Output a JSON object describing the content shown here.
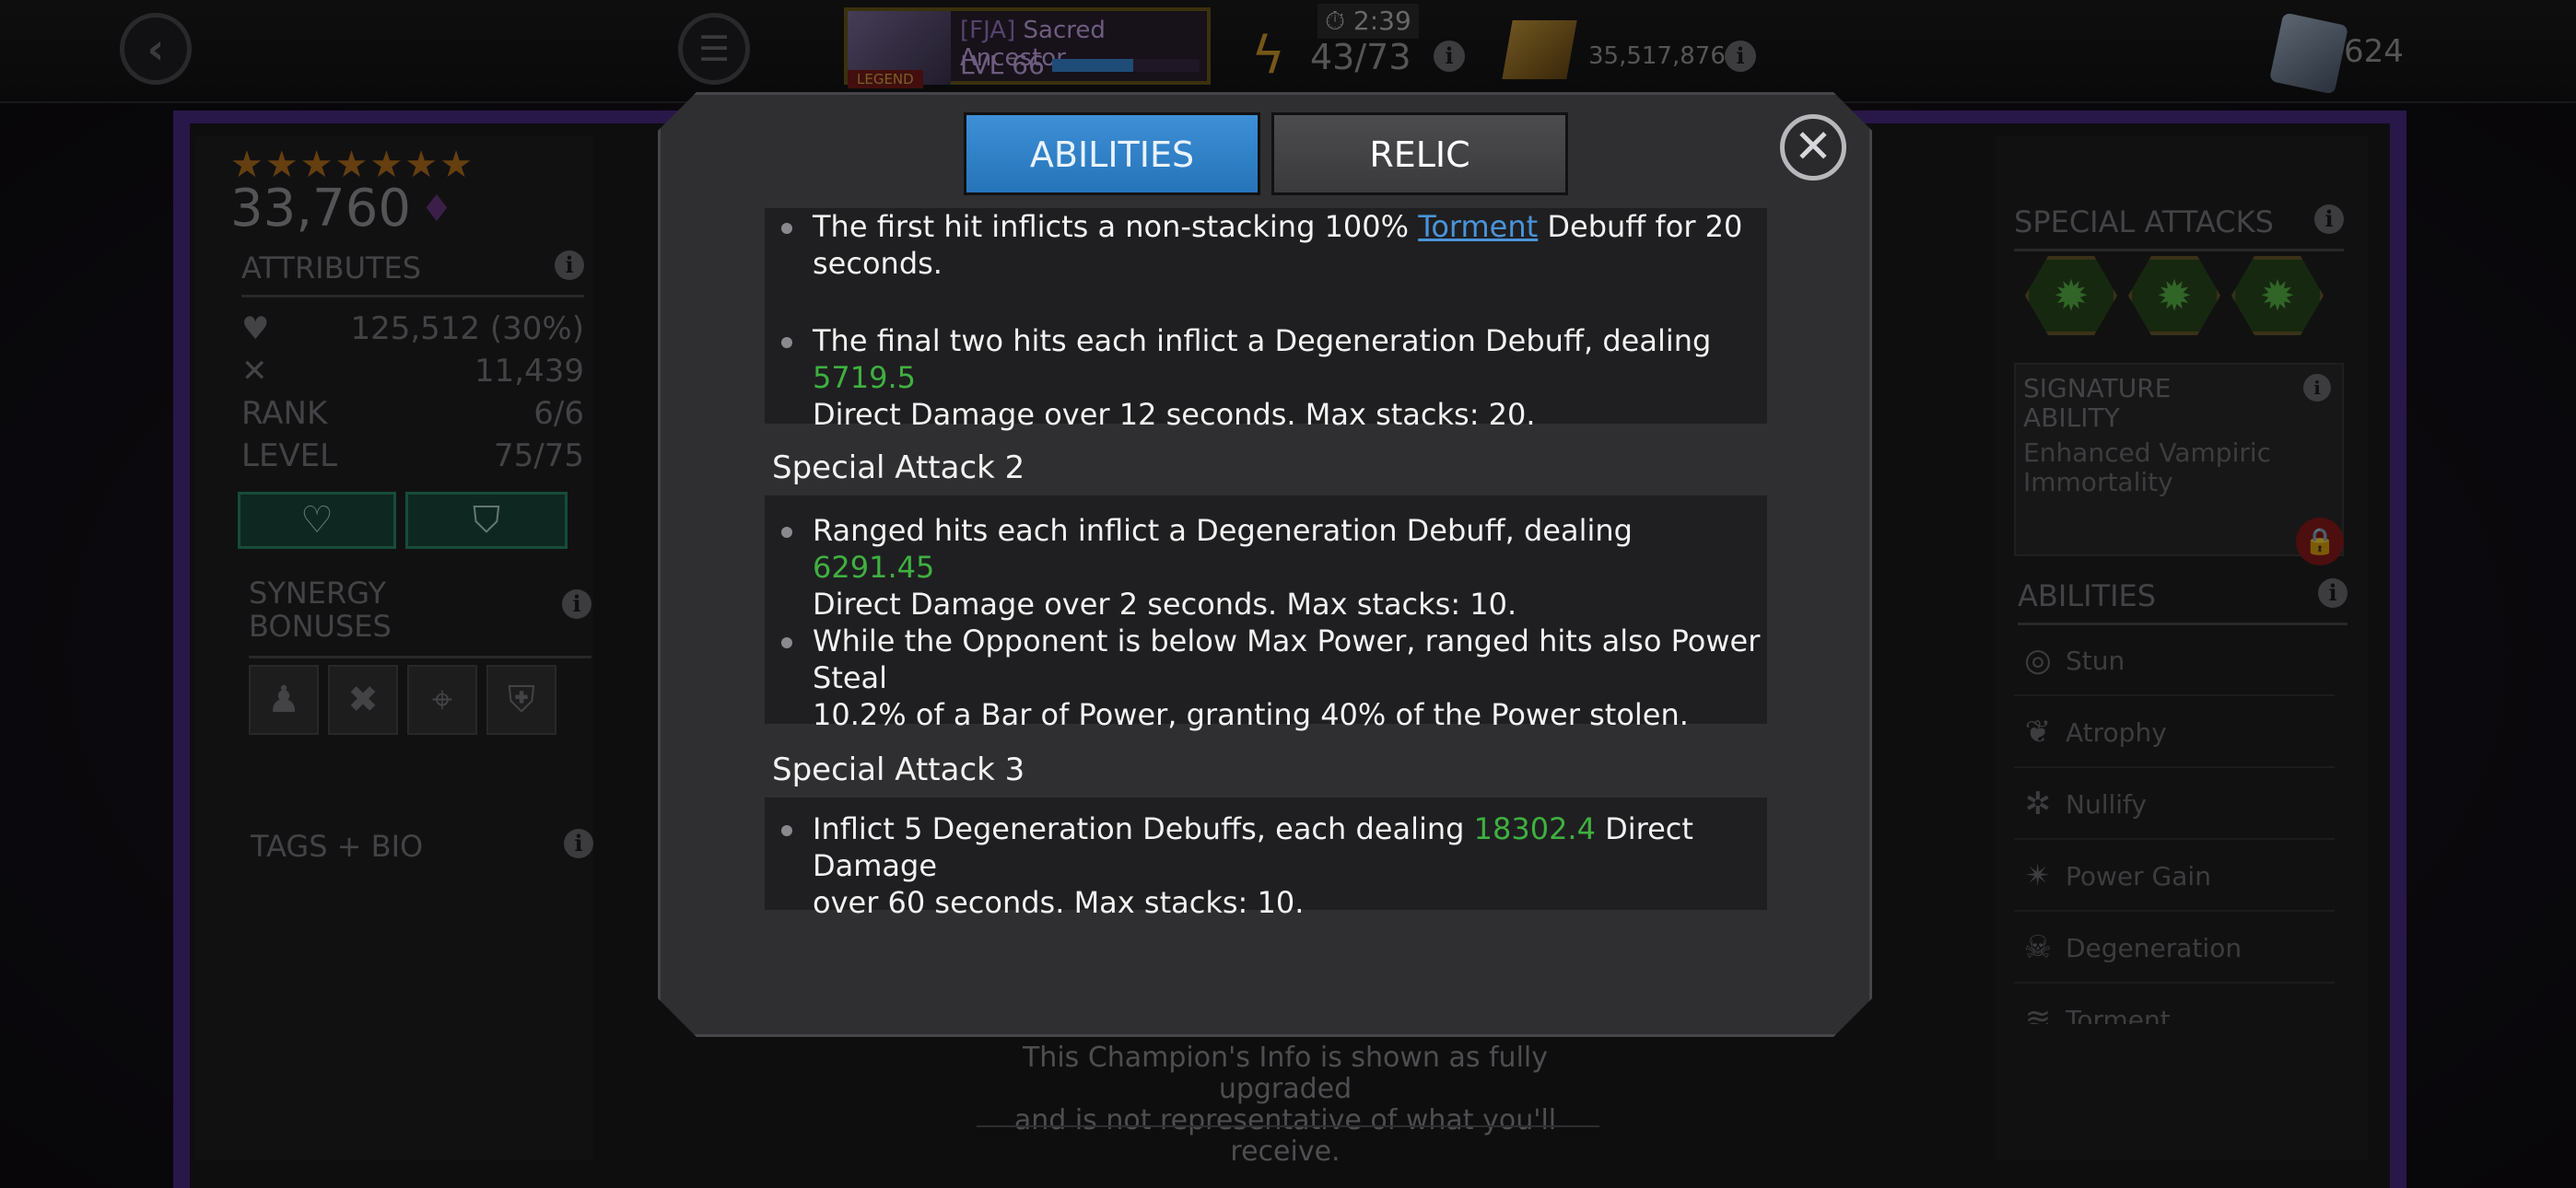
{
  "topbar": {
    "back_icon": "back-arrow-icon",
    "menu_icon": "hamburger-menu-icon",
    "profile": {
      "legend_badge": "LEGEND",
      "alliance_tag": "[FJA]",
      "name": "Sacred Ancestor",
      "level": "LVL 66",
      "level_progress": 0.55
    },
    "energy": {
      "timer": "2:39",
      "value": "43/73"
    },
    "gold": {
      "value": "35,517,876"
    },
    "units": {
      "value": "624"
    }
  },
  "champion": {
    "stars": "★★★★★★★",
    "rating": "33,760",
    "attributes": {
      "title": "ATTRIBUTES",
      "health": "125,512",
      "health_bonus": "30%",
      "attack": "11,439",
      "rank_label": "RANK",
      "rank": "6/6",
      "level_label": "LEVEL",
      "level": "75/75"
    },
    "synergy_title_line1": "SYNERGY",
    "synergy_title_line2": "BONUSES",
    "tags_bio": "TAGS + BIO"
  },
  "right_panel": {
    "special_attacks_title": "SPECIAL ATTACKS",
    "signature_title_line1": "SIGNATURE",
    "signature_title_line2": "ABILITY",
    "signature_name_line1": "Enhanced Vampiric",
    "signature_name_line2": "Immortality",
    "abilities_title": "ABILITIES",
    "abilities": [
      {
        "name": "Stun",
        "icon": "stun-icon"
      },
      {
        "name": "Atrophy",
        "icon": "atrophy-icon"
      },
      {
        "name": "Nullify",
        "icon": "nullify-icon"
      },
      {
        "name": "Power Gain",
        "icon": "power-gain-icon"
      },
      {
        "name": "Degeneration",
        "icon": "degeneration-icon"
      },
      {
        "name": "Torment",
        "icon": "torment-icon"
      }
    ]
  },
  "disclaimer_line1": "This Champion's Info is shown as fully upgraded",
  "disclaimer_line2": "and is not representative of what you'll receive.",
  "modal": {
    "tabs": {
      "abilities": "ABILITIES",
      "relic": "RELIC"
    },
    "sa1": {
      "b1_pre": "The first hit inflicts a non-stacking 100% ",
      "b1_link": "Torment",
      "b1_post": " Debuff for 20",
      "b1_line2": "seconds.",
      "b2_pre": "The final two hits each inflict a Degeneration Debuff, dealing ",
      "b2_value": "5719.5",
      "b2_line2": "Direct Damage over 12 seconds. Max stacks: 20."
    },
    "sa2": {
      "title": "Special Attack 2",
      "b1_pre": "Ranged hits each inflict a Degeneration Debuff, dealing ",
      "b1_value": "6291.45",
      "b1_line2": "Direct Damage over 2 seconds. Max stacks: 10.",
      "b2_line1": "While the Opponent is below Max Power, ranged hits also Power Steal",
      "b2_line2": "10.2% of a Bar of Power, granting 40% of the Power stolen."
    },
    "sa3": {
      "title": "Special Attack 3",
      "b1_pre": "Inflict 5 Degeneration Debuffs, each dealing ",
      "b1_value": "18302.4",
      "b1_post": " Direct Damage",
      "b1_line2": "over 60 seconds. Max stacks: 10."
    }
  }
}
